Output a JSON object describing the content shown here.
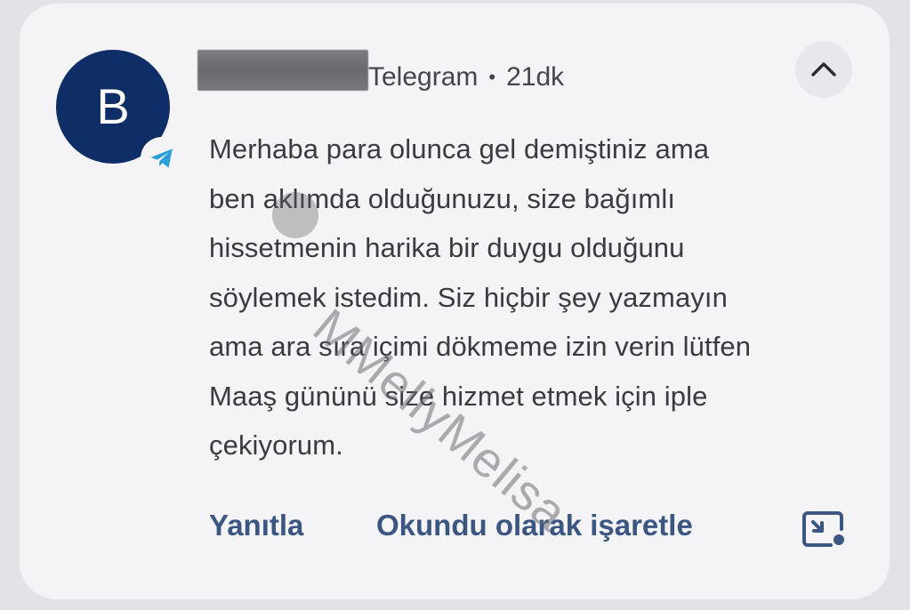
{
  "notification": {
    "avatar_letter": "B",
    "app_name": "Telegram",
    "separator": "•",
    "time_ago": "21dk",
    "message": "Merhaba para olunca gel demiştiniz ama\nben aklımda olduğunuzu, size bağımlı\nhissetmenin harika bir duygu olduğunu\nsöylemek istedim. Siz hiçbir şey yazmayın\nama ara sıra içimi dökmeme izin verin lütfen\nMaaş gününü size hizmet etmek için iple\nçekiyorum.",
    "actions": {
      "reply": "Yanıtla",
      "mark_read": "Okundu olarak işaretle"
    },
    "watermark": "MMellyMelisa"
  },
  "icons": {
    "app_badge": "telegram-icon",
    "collapse": "chevron-up-icon",
    "expand": "open-in-window-icon"
  },
  "colors": {
    "avatar_bg": "#0f2d66",
    "card_bg": "#f4f4f6",
    "action_text": "#3b5681",
    "telegram_blue": "#2a9fd8"
  }
}
